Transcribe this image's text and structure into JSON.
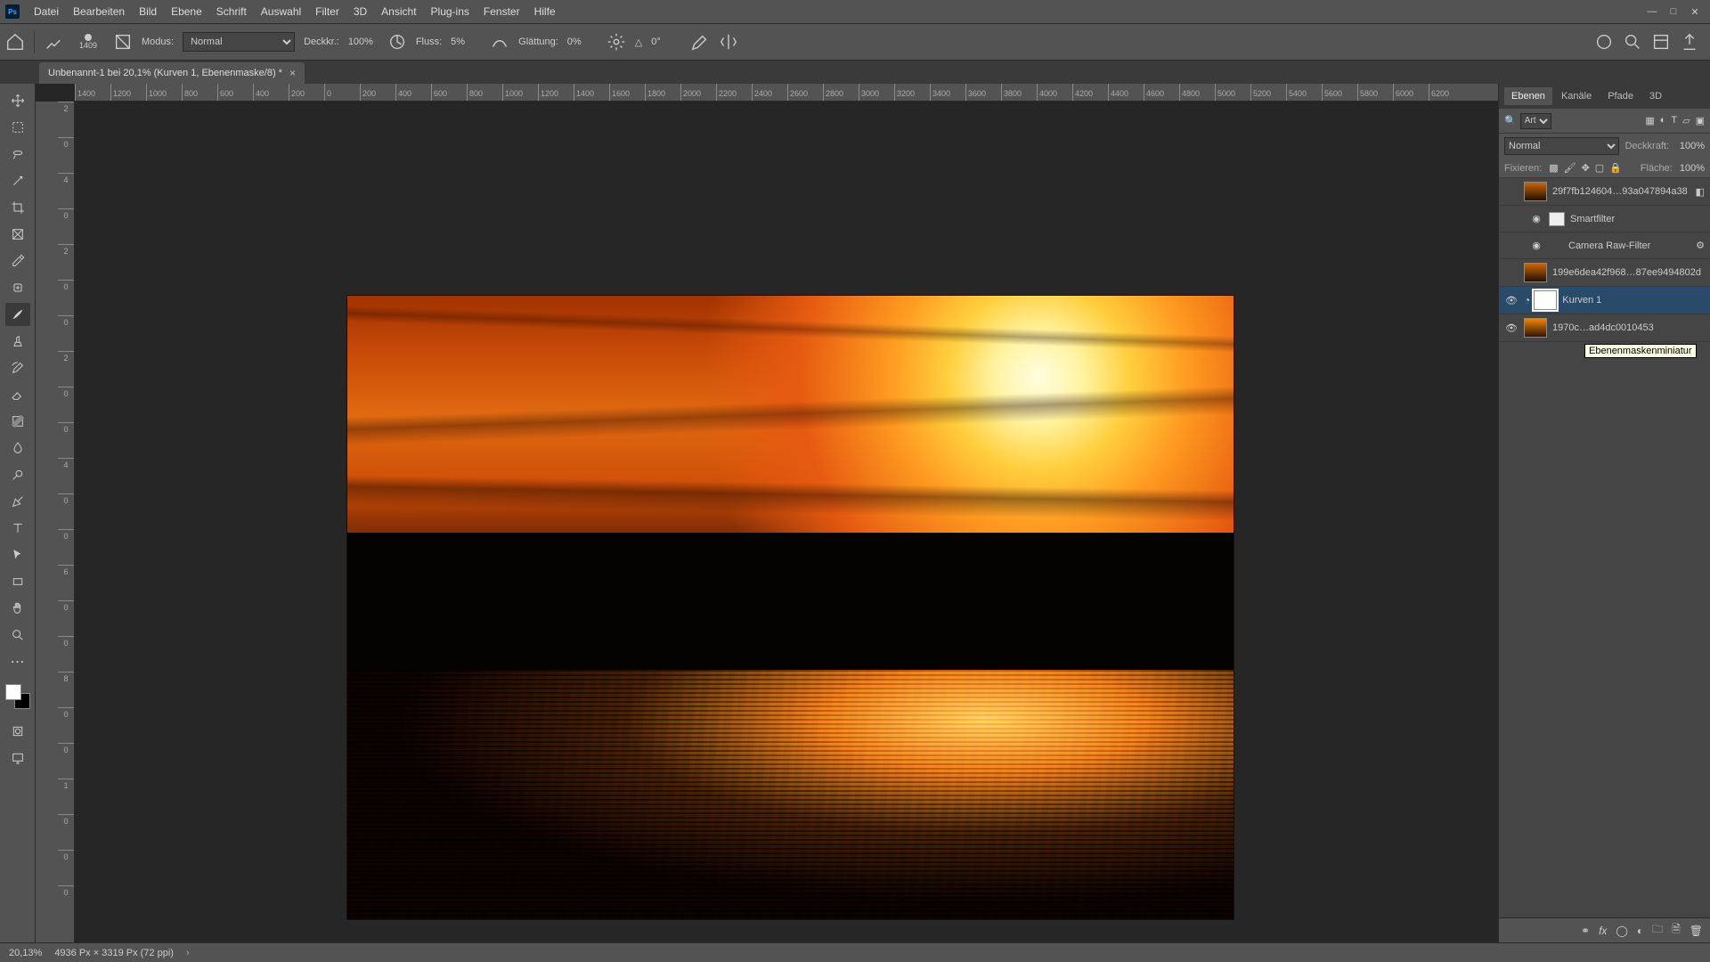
{
  "app_icon_text": "Ps",
  "menu": [
    "Datei",
    "Bearbeiten",
    "Bild",
    "Ebene",
    "Schrift",
    "Auswahl",
    "Filter",
    "3D",
    "Ansicht",
    "Plug-ins",
    "Fenster",
    "Hilfe"
  ],
  "options": {
    "brush_size": "1409",
    "mode_label": "Modus:",
    "mode_value": "Normal",
    "opacity_label": "Deckkr.:",
    "opacity_value": "100%",
    "flow_label": "Fluss:",
    "flow_value": "5%",
    "smoothing_label": "Glättung:",
    "smoothing_value": "0%",
    "angle_icon": "△",
    "angle_value": "0°"
  },
  "tab": {
    "title": "Unbenannt-1 bei 20,1% (Kurven 1, Ebenenmaske/8) *"
  },
  "ruler_ticks": [
    "1400",
    "1200",
    "1000",
    "800",
    "600",
    "400",
    "200",
    "0",
    "200",
    "400",
    "600",
    "800",
    "1000",
    "1200",
    "1400",
    "1600",
    "1800",
    "2000",
    "2200",
    "2400",
    "2600",
    "2800",
    "3000",
    "3200",
    "3400",
    "3600",
    "3800",
    "4000",
    "4200",
    "4400",
    "4600",
    "4800",
    "5000",
    "5200",
    "5400",
    "5600",
    "5800",
    "6000",
    "6200"
  ],
  "ruler_v": [
    "2",
    "0",
    "4",
    "0",
    "2",
    "0",
    "0",
    "2",
    "0",
    "0",
    "4",
    "0",
    "0",
    "6",
    "0",
    "0",
    "8",
    "0",
    "0",
    "1",
    "0",
    "0",
    "0"
  ],
  "panels": {
    "tabs": [
      "Ebenen",
      "Kanäle",
      "Pfade",
      "3D"
    ],
    "search_placeholder": "Art",
    "blend_mode": "Normal",
    "opacity_label": "Deckkraft:",
    "opacity_value": "100%",
    "fill_label": "Fläche:",
    "fill_value": "100%",
    "lock_label": "Fixieren:"
  },
  "layers": [
    {
      "name": "29f7fb124604…93a047894a38",
      "visible": false,
      "smart": true
    },
    {
      "name": "Smartfilter",
      "visible": true,
      "sub": true,
      "is_filter_header": true
    },
    {
      "name": "Camera Raw-Filter",
      "visible": true,
      "sub": true,
      "is_filter": true
    },
    {
      "name": "199e6dea42f968…87ee9494802d",
      "visible": false,
      "smart": true
    },
    {
      "name": "Kurven 1",
      "visible": true,
      "selected": true,
      "adjustment": true
    },
    {
      "name": "1970c…ad4dc0010453",
      "visible": true,
      "smart": true
    }
  ],
  "tooltip": "Ebenenmaskenminiatur",
  "status": {
    "zoom": "20,13%",
    "doc": "4936 Px × 3319 Px (72 ppi)"
  }
}
